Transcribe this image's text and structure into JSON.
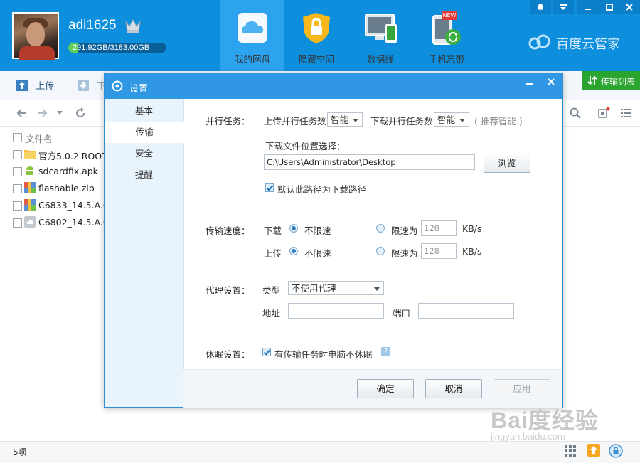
{
  "header": {
    "username": "adi1625",
    "quota_text": "291.92GB/3183.00GB",
    "quota_fraction": 0.0917,
    "nav": [
      {
        "label": "我的网盘",
        "icon": "cloud-icon"
      },
      {
        "label": "隐藏空间",
        "icon": "lock-icon"
      },
      {
        "label": "数据线",
        "icon": "devices-icon"
      },
      {
        "label": "手机忘带",
        "icon": "phone-sync-icon",
        "badge": "NEW"
      }
    ],
    "brand": "百度云管家"
  },
  "toolbar": {
    "upload": "上传",
    "download_partial": "下",
    "transfer_list": "传输列表"
  },
  "filelist": {
    "column_name": "文件名",
    "files": [
      {
        "name": "官方5.0.2 ROOT",
        "icon": "folder-icon"
      },
      {
        "name": "sdcardfix.apk",
        "icon": "android-icon"
      },
      {
        "name": "flashable.zip",
        "icon": "zip-icon"
      },
      {
        "name": "C6833_14.5.A.0.2",
        "icon": "zip-icon"
      },
      {
        "name": "C6802_14.5.A.0.2",
        "icon": "file-icon"
      }
    ],
    "count": "5项"
  },
  "dialog": {
    "title": "设置",
    "side": [
      "基本",
      "传输",
      "安全",
      "提醒"
    ],
    "selected_side": "传输",
    "parallel": {
      "label": "并行任务：",
      "upload_label": "上传并行任务数",
      "upload_value": "智能",
      "download_label": "下载并行任务数",
      "download_value": "智能",
      "hint": "( 推荐智能 )"
    },
    "download_location": {
      "label": "下载文件位置选择：",
      "path": "C:\\Users\\Administrator\\Desktop",
      "browse": "浏览",
      "default_check": "默认此路径为下载路径"
    },
    "speed": {
      "label": "传输速度：",
      "download": "下载",
      "upload": "上传",
      "unlimited": "不限速",
      "limit": "限速为",
      "download_limit_value": "128",
      "upload_limit_value": "128",
      "unit": "KB/s"
    },
    "proxy": {
      "label": "代理设置：",
      "type_label": "类型",
      "type_value": "不使用代理",
      "address_label": "地址",
      "port_label": "端口"
    },
    "sleep": {
      "label": "休眠设置：",
      "check": "有传输任务时电脑不休眠",
      "help": "?"
    },
    "buttons": {
      "ok": "确定",
      "cancel": "取消",
      "apply": "应用"
    }
  },
  "watermark": {
    "main": "Bai度经验",
    "sub": "jingyan.baidu.com"
  }
}
